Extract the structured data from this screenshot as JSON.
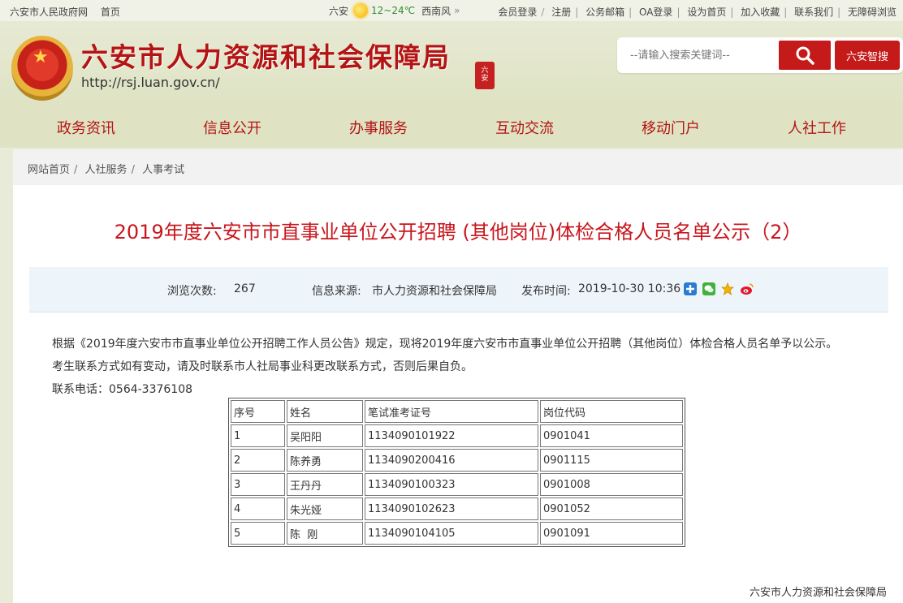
{
  "topbar": {
    "left_links": [
      "六安市人民政府网",
      "首页"
    ],
    "weather": {
      "city": "六安",
      "temp": "12~24℃",
      "wind": "西南风"
    },
    "right_links": [
      "会员登录",
      "注册",
      "公务邮箱",
      "OA登录",
      "设为首页",
      "加入收藏",
      "联系我们",
      "无障碍浏览"
    ]
  },
  "header": {
    "title": "六安市人力资源和社会保障局",
    "url": "http://rsj.luan.gov.cn/",
    "search_placeholder": "--请输入搜索关键词--",
    "smart_button": "六安智搜"
  },
  "nav": [
    "政务资讯",
    "信息公开",
    "办事服务",
    "互动交流",
    "移动门户",
    "人社工作"
  ],
  "breadcrumb": [
    "网站首页",
    "人社服务",
    "人事考试"
  ],
  "article": {
    "title": "2019年度六安市市直事业单位公开招聘 (其他岗位)体检合格人员名单公示（2）",
    "views_label": "浏览次数:",
    "views": "267",
    "source_label": "信息来源:",
    "source": "市人力资源和社会保障局",
    "date_label": "发布时间:",
    "date": "2019-10-30 10:36",
    "paragraphs": [
      "根据《2019年度六安市市直事业单位公开招聘工作人员公告》规定，现将2019年度六安市市直事业单位公开招聘（其他岗位）体检合格人员名单予以公示。",
      "考生联系方式如有变动，请及时联系市人社局事业科更改联系方式，否则后果自负。",
      "联系电话：0564-3376108"
    ],
    "table": {
      "headers": [
        "序号",
        "姓名",
        "笔试准考证号",
        "岗位代码"
      ],
      "rows": [
        [
          "1",
          "吴阳阳",
          "1134090101922",
          "0901041"
        ],
        [
          "2",
          "陈养勇",
          "1134090200416",
          "0901115"
        ],
        [
          "3",
          "王丹丹",
          "1134090100323",
          "0901008"
        ],
        [
          "4",
          "朱光娅",
          "1134090102623",
          "0901052"
        ],
        [
          "5",
          "陈  刚",
          "1134090104105",
          "0901091"
        ]
      ]
    },
    "signature": "六安市人力资源和社会保障局"
  }
}
